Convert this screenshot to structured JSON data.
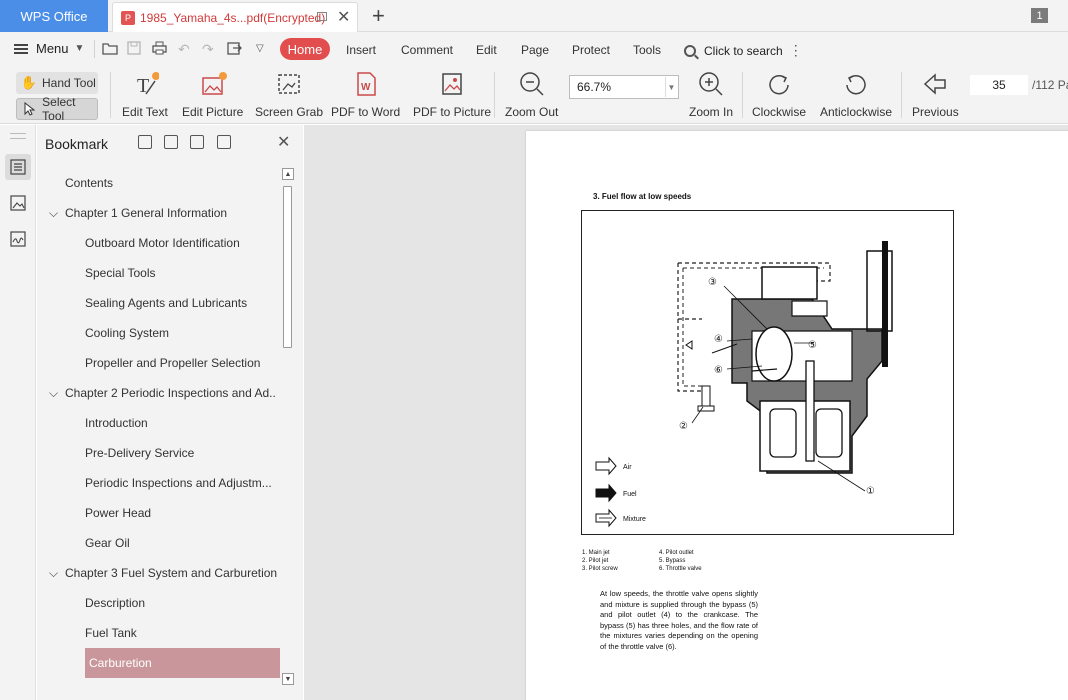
{
  "app": {
    "name": "WPS Office"
  },
  "tabs": {
    "document_title": "1985_Yamaha_4s...pdf(Encrypted)",
    "new_tab_symbol": "+",
    "window_count": "1"
  },
  "menubar": {
    "menu_label": "Menu",
    "tabs": [
      "Home",
      "Insert",
      "Comment",
      "Edit",
      "Page",
      "Protect",
      "Tools"
    ],
    "active_tab": "Home",
    "search_label": "Click to search"
  },
  "ribbon": {
    "hand_tool": "Hand Tool",
    "select_tool": "Select Tool",
    "edit_text": "Edit Text",
    "edit_picture": "Edit Picture",
    "screen_grab": "Screen Grab",
    "pdf_to_word": "PDF to Word",
    "pdf_to_picture": "PDF to Picture",
    "zoom_out": "Zoom Out",
    "zoom_value": "66.7%",
    "zoom_in": "Zoom In",
    "clockwise": "Clockwise",
    "anticlockwise": "Anticlockwise",
    "previous": "Previous",
    "current_page": "35",
    "total_pages": "/112 Pa"
  },
  "bookmark": {
    "title": "Bookmark",
    "items": [
      {
        "label": "Contents",
        "level": 0,
        "expandable": false
      },
      {
        "label": "Chapter 1 General Information",
        "level": 0,
        "expandable": true
      },
      {
        "label": "Outboard Motor Identification",
        "level": 1
      },
      {
        "label": "Special Tools",
        "level": 1
      },
      {
        "label": "Sealing Agents and Lubricants",
        "level": 1
      },
      {
        "label": "Cooling System",
        "level": 1
      },
      {
        "label": "Propeller and Propeller Selection",
        "level": 1
      },
      {
        "label": "Chapter 2 Periodic Inspections and Ad..",
        "level": 0,
        "expandable": true
      },
      {
        "label": "Introduction",
        "level": 1
      },
      {
        "label": "Pre-Delivery Service",
        "level": 1
      },
      {
        "label": "Periodic Inspections and Adjustm...",
        "level": 1
      },
      {
        "label": "Power Head",
        "level": 1
      },
      {
        "label": "Gear Oil",
        "level": 1
      },
      {
        "label": "Chapter 3 Fuel System and Carburetion",
        "level": 0,
        "expandable": true
      },
      {
        "label": "Description",
        "level": 1
      },
      {
        "label": "Fuel Tank",
        "level": 1
      },
      {
        "label": "Carburetion",
        "level": 1,
        "selected": true
      }
    ]
  },
  "document_page": {
    "heading": "3. Fuel flow at low speeds",
    "callouts": [
      "①",
      "②",
      "③",
      "④",
      "⑤",
      "⑥"
    ],
    "legend": [
      "Air",
      "Fuel",
      "Mixture"
    ],
    "parts_left": [
      "1.  Main jet",
      "2.  Pilot jet",
      "3.  Pilot screw"
    ],
    "parts_right": [
      "4.  Pilot outlet",
      "5.  Bypass",
      "6.  Throttle valve"
    ],
    "body": "At low speeds, the throttle valve opens slightly and mixture is supplied through the bypass (5) and pilot outlet (4) to the crankcase. The bypass (5) has three holes, and the flow rate of the mixtures varies depending on the opening of the throttle valve (6)."
  },
  "colors": {
    "app_tab": "#4b8ee8",
    "home_tab": "#e24d4d",
    "doc_title": "#d13a3a",
    "selected_bookmark": "#c9979b"
  }
}
